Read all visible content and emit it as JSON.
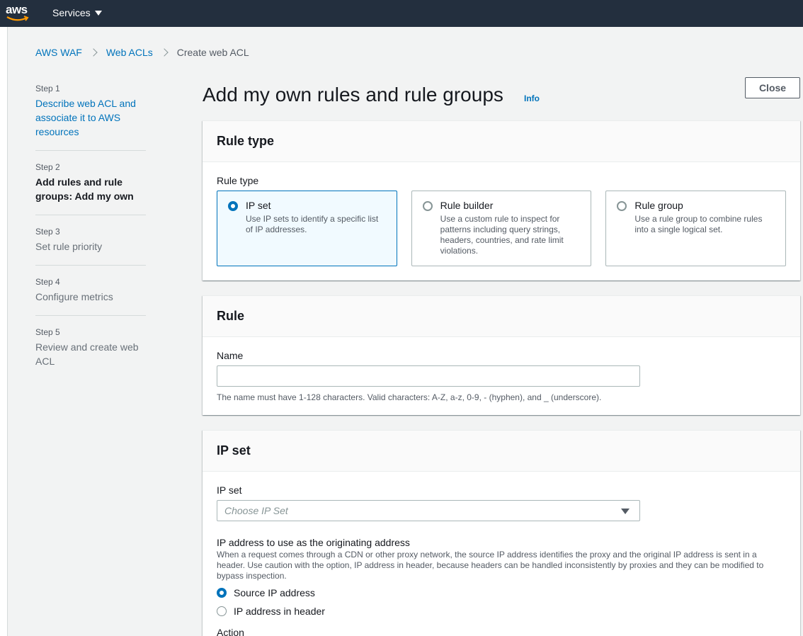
{
  "nav": {
    "logo_text": "aws",
    "services_label": "Services"
  },
  "breadcrumb": {
    "item1": "AWS WAF",
    "item2": "Web ACLs",
    "current": "Create web ACL"
  },
  "steps": [
    {
      "num": "Step 1",
      "title": "Describe web ACL and associate it to AWS resources"
    },
    {
      "num": "Step 2",
      "title": "Add rules and rule groups: Add my own"
    },
    {
      "num": "Step 3",
      "title": "Set rule priority"
    },
    {
      "num": "Step 4",
      "title": "Configure metrics"
    },
    {
      "num": "Step 5",
      "title": "Review and create web ACL"
    }
  ],
  "header": {
    "title": "Add my own rules and rule groups",
    "info": "Info",
    "close": "Close"
  },
  "rule_type": {
    "section_title": "Rule type",
    "label": "Rule type",
    "tiles": [
      {
        "title": "IP set",
        "desc": "Use IP sets to identify a specific list of IP addresses."
      },
      {
        "title": "Rule builder",
        "desc": "Use a custom rule to inspect for patterns including query strings, headers, countries, and rate limit violations."
      },
      {
        "title": "Rule group",
        "desc": "Use a rule group to combine rules into a single logical set."
      }
    ]
  },
  "rule": {
    "section_title": "Rule",
    "name_label": "Name",
    "name_value": "",
    "hint": "The name must have 1-128 characters. Valid characters: A-Z, a-z, 0-9, - (hyphen), and _ (underscore)."
  },
  "ip_set": {
    "section_title": "IP set",
    "label": "IP set",
    "placeholder": "Choose IP Set",
    "origin_label": "IP address to use as the originating address",
    "origin_desc": "When a request comes through a CDN or other proxy network, the source IP address identifies the proxy and the original IP address is sent in a header. Use caution with the option, IP address in header, because headers can be handled inconsistently by proxies and they can be modified to bypass inspection.",
    "options": [
      "Source IP address",
      "IP address in header"
    ],
    "next_label": "Action"
  },
  "colors": {
    "nav_bg": "#232f3e",
    "link": "#0073bb",
    "selected_bg": "#f1faff",
    "logo_orange": "#ff9900"
  }
}
